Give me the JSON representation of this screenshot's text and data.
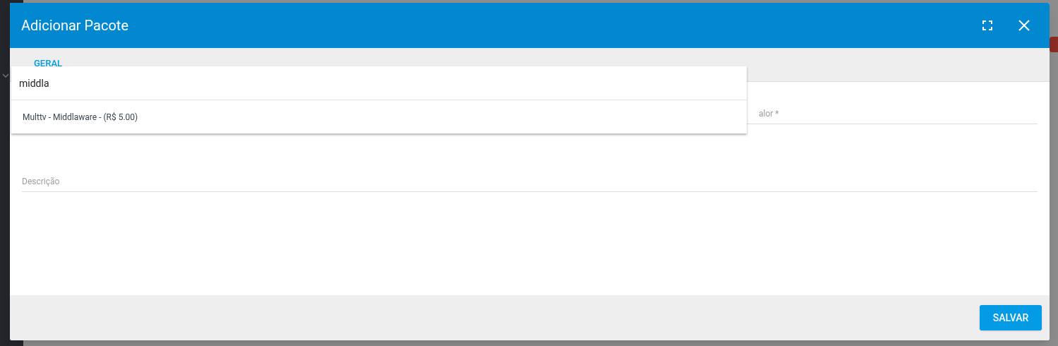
{
  "dialog": {
    "title": "Adicionar Pacote"
  },
  "tabs": [
    {
      "label": "GERAL",
      "selected": true
    }
  ],
  "search": {
    "value": "middla"
  },
  "options": [
    {
      "label": "Multtv - Middlaware - (R$ 5.00)",
      "selected": false
    }
  ],
  "fields": [
    {
      "label": "alor *"
    },
    {
      "label": "Descrição"
    }
  ],
  "buttons": [
    {
      "label": "SALVAR"
    }
  ]
}
